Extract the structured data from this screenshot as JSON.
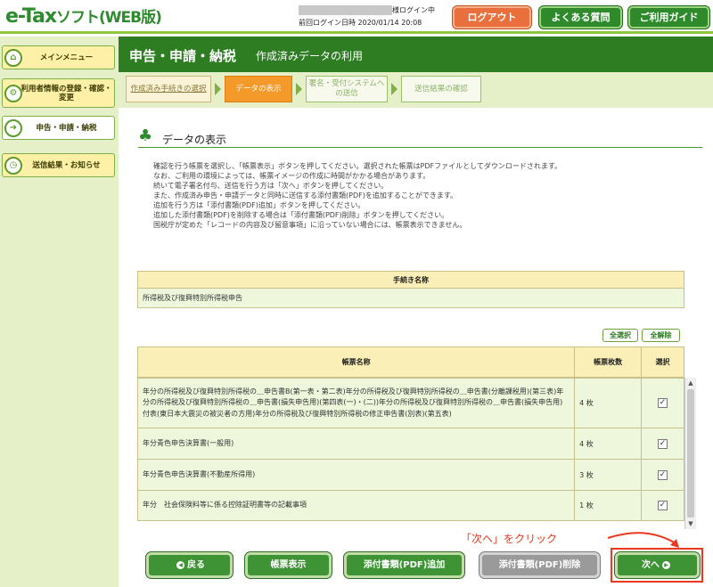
{
  "header": {
    "logo_main": "e-Tax",
    "logo_sub": "ソフト(WEB版)",
    "login_status": "様ログイン中",
    "last_login": "前回ログイン日時  2020/01/14 20:08",
    "logout_label": "ログアウト",
    "faq_label": "よくある質問",
    "guide_label": "ご利用ガイド"
  },
  "sidebar": {
    "items": [
      {
        "label": "メインメニュー",
        "icon": "home-icon"
      },
      {
        "label": "利用者情報の登録・確認・変更",
        "icon": "settings-icon"
      },
      {
        "label": "申告・申請・納税",
        "icon": "submit-icon"
      },
      {
        "label": "送信結果・お知らせ",
        "icon": "clock-icon"
      }
    ]
  },
  "title_bar": {
    "title": "申告・申請・納税",
    "subtitle": "作成済みデータの利用"
  },
  "steps": [
    {
      "label": "作成済み手続きの選択",
      "state": "done"
    },
    {
      "label": "データの表示",
      "state": "current"
    },
    {
      "label": "署名・受付システムへの送信",
      "state": "todo"
    },
    {
      "label": "送信結果の確認",
      "state": "todo"
    }
  ],
  "section": {
    "title": "データの表示"
  },
  "description": [
    "確認を行う帳票を選択し、「帳票表示」ボタンを押してください。選択された帳票はPDFファイルとしてダウンロードされます。",
    "なお、ご利用の環境によっては、帳票イメージの作成に時間がかかる場合があります。",
    "続いて電子署名付与、送信を行う方は「次へ」ボタンを押してください。",
    "また、作成済み申告・申請データと同時に送信する添付書類(PDF)を追加することができます。",
    "追加を行う方は「添付書類(PDF)追加」ボタンを押してください。",
    "追加した添付書類(PDF)を削除する場合は「添付書類(PDF)削除」ボタンを押してください。",
    "国税庁が定めた「レコードの内容及び留意事項」に沿っていない場合には、帳票表示できません。"
  ],
  "procedure": {
    "header": "手続き名称",
    "value": "所得税及び復興特別所得税申告"
  },
  "select_all_label": "全選択",
  "clear_all_label": "全解除",
  "forms": {
    "col_name": "帳票名称",
    "col_count": "帳票枚数",
    "col_select": "選択",
    "rows": [
      {
        "name": "年分の所得税及び復興特別所得税の＿申告書B(第一表・第二表)年分の所得税及び復興特別所得税の＿申告書(分離課税用)(第三表)年分の所得税及び復興特別所得税の＿申告書(損失申告用)(第四表(一)・(二))年分の所得税及び復興特別所得税の＿申告書(損失申告用)付表(東日本大震災の被災者の方用)年分の所得税及び復興特別所得税の修正申告書(別表)(第五表)",
        "count": "4 枚",
        "checked": "✓"
      },
      {
        "name": "年分青色申告決算書(一般用)",
        "count": "4 枚",
        "checked": "✓"
      },
      {
        "name": "年分青色申告決算書(不動産所得用)",
        "count": "3 枚",
        "checked": "✓"
      },
      {
        "name": "年分　社会保険料等に係る控除証明書等の記載事項",
        "count": "1 枚",
        "checked": "✓"
      }
    ]
  },
  "annotation": "「次へ」をクリック",
  "buttons": {
    "back": "戻る",
    "display": "帳票表示",
    "add_pdf": "添付書類(PDF)追加",
    "delete_pdf": "添付書類(PDF)削除",
    "next": "次へ"
  },
  "colors": {
    "brand_green": "#2e7d23",
    "accent_orange": "#f39a2b",
    "annotation_red": "#e8391e"
  }
}
